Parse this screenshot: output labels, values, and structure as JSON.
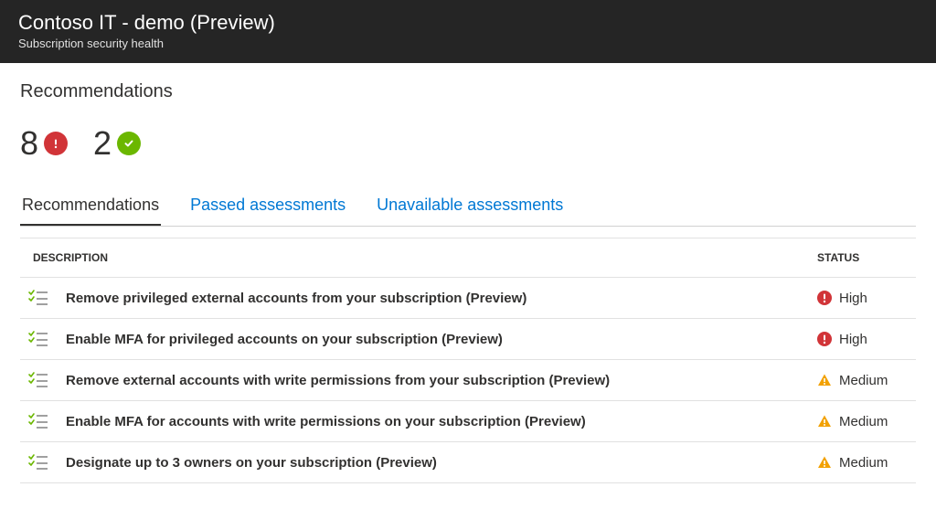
{
  "header": {
    "title": "Contoso IT - demo (Preview)",
    "subtitle": "Subscription security health"
  },
  "section_title": "Recommendations",
  "counts": {
    "alert": "8",
    "passed": "2"
  },
  "tabs": {
    "recommendations": "Recommendations",
    "passed": "Passed assessments",
    "unavailable": "Unavailable assessments"
  },
  "columns": {
    "description": "Description",
    "status": "Status"
  },
  "status_labels": {
    "high": "High",
    "medium": "Medium"
  },
  "rows": [
    {
      "description": "Remove privileged external accounts from your subscription (Preview)",
      "status": "High"
    },
    {
      "description": "Enable MFA for privileged accounts on your subscription (Preview)",
      "status": "High"
    },
    {
      "description": "Remove external accounts with write permissions from your subscription (Preview)",
      "status": "Medium"
    },
    {
      "description": "Enable MFA for accounts with write permissions on your subscription (Preview)",
      "status": "Medium"
    },
    {
      "description": "Designate up to 3 owners on your subscription (Preview)",
      "status": "Medium"
    }
  ]
}
